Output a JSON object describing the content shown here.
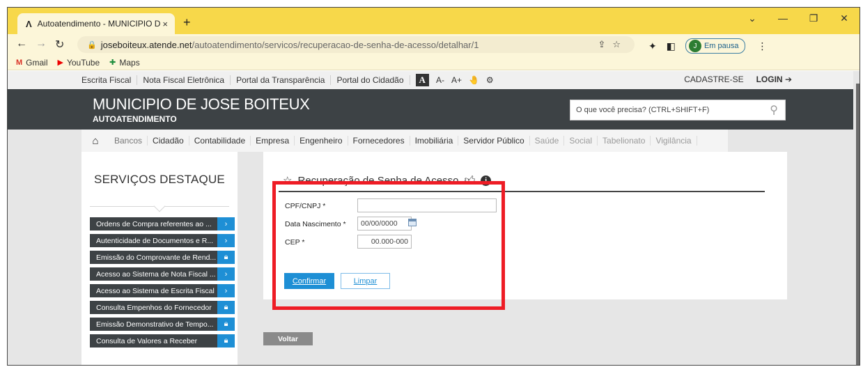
{
  "browser": {
    "tab_title": "Autoatendimento - MUNICIPIO D",
    "tab_close": "×",
    "new_tab": "+",
    "url_host": "joseboiteux.atende.net",
    "url_path": "/autoatendimento/servicos/recuperacao-de-senha-de-acesso/detalhar/1",
    "profile_initial": "J",
    "profile_status": "Em pausa",
    "bookmarks": [
      "Gmail",
      "YouTube",
      "Maps"
    ]
  },
  "topnav": {
    "links": [
      "Escrita Fiscal",
      "Nota Fiscal Eletrônica",
      "Portal da Transparência",
      "Portal do Cidadão"
    ],
    "font_a": "A",
    "font_minus": "A-",
    "font_plus": "A+",
    "register": "CADASTRE-SE",
    "login": "LOGIN"
  },
  "header": {
    "title": "MUNICIPIO DE JOSE BOITEUX",
    "subtitle": "AUTOATENDIMENTO",
    "search_placeholder": "O que você precisa? (CTRL+SHIFT+F)"
  },
  "categories": [
    {
      "label": "Bancos",
      "style": "mid"
    },
    {
      "label": "Cidadão",
      "style": "normal"
    },
    {
      "label": "Contabilidade",
      "style": "normal"
    },
    {
      "label": "Empresa",
      "style": "normal"
    },
    {
      "label": "Engenheiro",
      "style": "normal"
    },
    {
      "label": "Fornecedores",
      "style": "normal"
    },
    {
      "label": "Imobiliária",
      "style": "normal"
    },
    {
      "label": "Servidor Público",
      "style": "normal"
    },
    {
      "label": "Saúde",
      "style": "dim"
    },
    {
      "label": "Social",
      "style": "dim"
    },
    {
      "label": "Tabelionato",
      "style": "dim"
    },
    {
      "label": "Vigilância",
      "style": "dim"
    }
  ],
  "sidebar": {
    "title": "SERVIÇOS DESTAQUE",
    "items": [
      {
        "label": "Ordens de Compra referentes ao ...",
        "icon": "arrow"
      },
      {
        "label": "Autenticidade de Documentos e R...",
        "icon": "arrow"
      },
      {
        "label": "Emissão do Comprovante de Rend...",
        "icon": "lock"
      },
      {
        "label": "Acesso ao Sistema de Nota Fiscal ...",
        "icon": "arrow"
      },
      {
        "label": "Acesso ao Sistema de Escrita Fiscal",
        "icon": "arrow"
      },
      {
        "label": "Consulta Empenhos do Fornecedor",
        "icon": "lock"
      },
      {
        "label": "Emissão Demonstrativo de Tempo...",
        "icon": "lock"
      },
      {
        "label": "Consulta de Valores a Receber",
        "icon": "lock"
      }
    ]
  },
  "form": {
    "title": "Recuperação de Senha de Acesso",
    "cpf_label": "CPF/CNPJ *",
    "cpf_value": "",
    "birth_label": "Data Nascimento *",
    "birth_placeholder": "00/00/0000",
    "cep_label": "CEP *",
    "cep_placeholder": "00.000-000",
    "confirm": "Confirmar",
    "clear": "Limpar"
  },
  "back": "Voltar",
  "colors": {
    "accent": "#1e8fd5",
    "header_bg": "#3d4245",
    "highlight": "#ee1c25",
    "tab_strip": "#f7d84a"
  }
}
